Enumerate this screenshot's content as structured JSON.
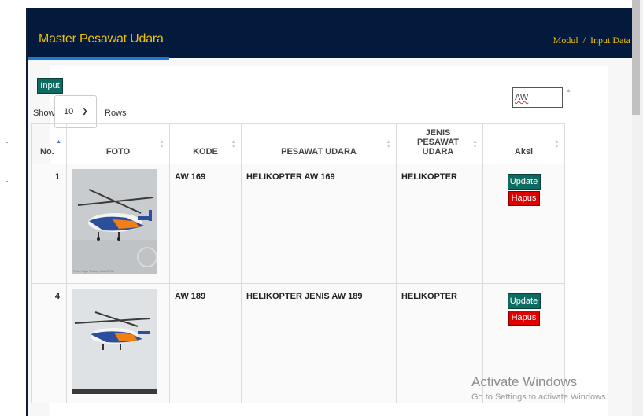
{
  "header": {
    "title": "Master Pesawat Udara",
    "breadcrumb": [
      "Modul",
      "/",
      "Input Data"
    ]
  },
  "toolbar": {
    "input_label": "Input"
  },
  "length_menu": {
    "show_label": "Show",
    "value": "10",
    "rows_label": "Rows"
  },
  "search": {
    "value": "AW"
  },
  "table": {
    "columns": [
      "No.",
      "FOTO",
      "KODE",
      "PESAWAT UDARA",
      "JENIS PESAWAT UDARA",
      "Aksi"
    ],
    "rows": [
      {
        "no": "1",
        "kode": "AW 169",
        "pesawat": "HELIKOPTER AW 169",
        "jenis": "HELIKOPTER",
        "photo_caption": "Foto: Fajar Tobing /GALERIB"
      },
      {
        "no": "4",
        "kode": "AW 189",
        "pesawat": "HELIKOPTER JENIS AW 189",
        "jenis": "HELIKOPTER"
      }
    ],
    "update_label": "Update",
    "hapus_label": "Hapus"
  },
  "watermark": {
    "line1": "Activate Windows",
    "line2": "Go to Settings to activate Windows."
  },
  "colors": {
    "header_bg": "#031a3d",
    "title": "#f2c200",
    "accent": "#1f78d6",
    "btn_green": "#0d6b61",
    "btn_red": "#e00000"
  }
}
